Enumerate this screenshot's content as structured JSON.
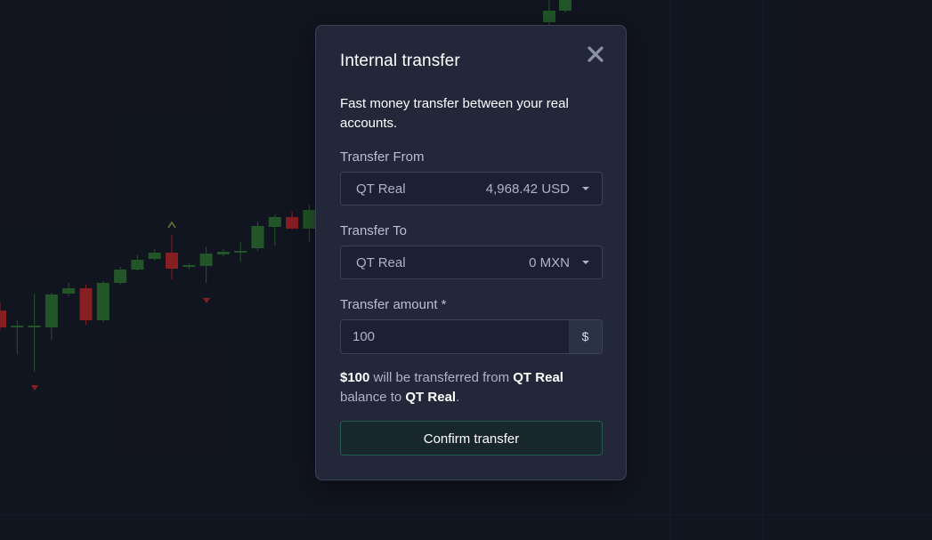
{
  "modal": {
    "title": "Internal transfer",
    "description": "Fast money transfer between your real accounts.",
    "close_icon": "close-icon",
    "transfer_from": {
      "label": "Transfer From",
      "account_name": "QT Real",
      "account_value": "4,968.42 USD"
    },
    "transfer_to": {
      "label": "Transfer To",
      "account_name": "QT Real",
      "account_value": "0 MXN"
    },
    "amount": {
      "label": "Transfer amount *",
      "value": "100",
      "currency_symbol": "$"
    },
    "summary": {
      "amount": "$100",
      "text_1": " will be transferred from ",
      "from_account": "QT Real",
      "text_2": " balance to ",
      "to_account": "QT Real",
      "text_3": "."
    },
    "confirm_label": "Confirm transfer"
  },
  "colors": {
    "background": "#151924",
    "modal_bg": "#22283a",
    "candle_up": "#2e7d32",
    "candle_down": "#c62828",
    "confirm_border": "#245b4e"
  },
  "chart_data": {
    "type": "candlestick",
    "candles": [
      {
        "o": 349,
        "h": 340,
        "l": 371,
        "c": 368,
        "dir": "down"
      },
      {
        "o": 368,
        "h": 360,
        "l": 398,
        "c": 366,
        "dir": "up"
      },
      {
        "o": 367,
        "h": 330,
        "l": 418,
        "c": 366,
        "dir": "up"
      },
      {
        "o": 368,
        "h": 329,
        "l": 382,
        "c": 331,
        "dir": "up"
      },
      {
        "o": 330,
        "h": 318,
        "l": 333,
        "c": 324,
        "dir": "up"
      },
      {
        "o": 324,
        "h": 320,
        "l": 365,
        "c": 360,
        "dir": "down"
      },
      {
        "o": 360,
        "h": 316,
        "l": 362,
        "c": 318,
        "dir": "up"
      },
      {
        "o": 318,
        "h": 300,
        "l": 320,
        "c": 303,
        "dir": "up"
      },
      {
        "o": 303,
        "h": 287,
        "l": 304,
        "c": 292,
        "dir": "up"
      },
      {
        "o": 291,
        "h": 280,
        "l": 293,
        "c": 284,
        "dir": "up"
      },
      {
        "o": 284,
        "h": 264,
        "l": 314,
        "c": 302,
        "dir": "down"
      },
      {
        "o": 300,
        "h": 296,
        "l": 303,
        "c": 298,
        "dir": "up"
      },
      {
        "o": 299,
        "h": 277,
        "l": 318,
        "c": 285,
        "dir": "up"
      },
      {
        "o": 286,
        "h": 280,
        "l": 288,
        "c": 283,
        "dir": "up"
      },
      {
        "o": 284,
        "h": 272,
        "l": 294,
        "c": 282,
        "dir": "up"
      },
      {
        "o": 279,
        "h": 249,
        "l": 282,
        "c": 254,
        "dir": "up"
      },
      {
        "o": 255,
        "h": 241,
        "l": 276,
        "c": 244,
        "dir": "up"
      },
      {
        "o": 244,
        "h": 238,
        "l": 258,
        "c": 257,
        "dir": "down"
      },
      {
        "o": 257,
        "h": 230,
        "l": 272,
        "c": 236,
        "dir": "up"
      }
    ],
    "top_candles": [
      {
        "o": 25,
        "h": 0,
        "l": 28,
        "c": 12,
        "dir": "up"
      },
      {
        "o": 12,
        "h": 0,
        "l": 14,
        "c": 0,
        "dir": "up"
      }
    ],
    "markers": [
      {
        "type": "down",
        "color": "#c62828"
      },
      {
        "type": "up",
        "color": "#9aa63a"
      },
      {
        "type": "down",
        "color": "#c62828"
      }
    ]
  }
}
